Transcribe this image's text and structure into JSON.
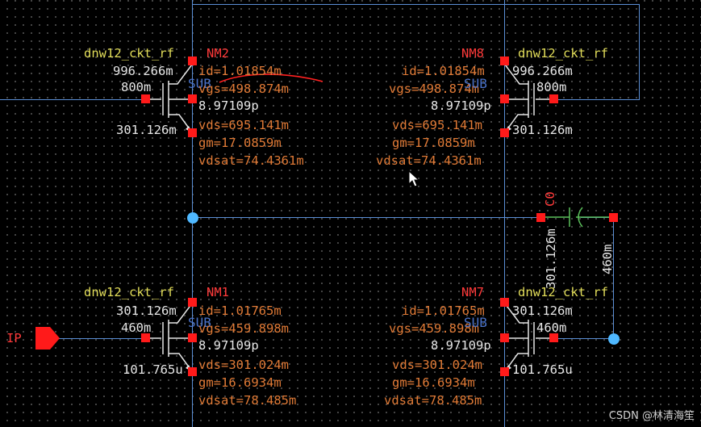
{
  "transistors": [
    {
      "name": "NM2",
      "model": "dnw12_ckt_rf",
      "w": "996.266m",
      "l": "800m",
      "bulk": "SUB",
      "cap": "8.97109p",
      "src": "301.126m",
      "id": "id=1.01854m",
      "vgs": "vgs=498.874m",
      "vds": "vds=695.141m",
      "gm": "gm=17.0859m",
      "vdsat": "vdsat=74.4361m"
    },
    {
      "name": "NM8",
      "model": "dnw12_ckt_rf",
      "w": "996.266m",
      "l": "800m",
      "bulk": "SUB",
      "cap": "8.97109p",
      "src": "301.126m",
      "id": "id=1.01854m",
      "vgs": "vgs=498.874m",
      "vds": "vds=695.141m",
      "gm": "gm=17.0859m",
      "vdsat": "vdsat=74.4361m"
    },
    {
      "name": "NM1",
      "model": "dnw12_ckt_rf",
      "w": "301.126m",
      "l": "460m",
      "bulk": "SUB",
      "cap": "8.97109p",
      "src": "101.765u",
      "id": "id=1.01765m",
      "vgs": "vgs=459.898m",
      "vds": "vds=301.024m",
      "gm": "gm=16.6934m",
      "vdsat": "vdsat=78.485m"
    },
    {
      "name": "NM7",
      "model": "dnw12_ckt_rf",
      "w": "301.126m",
      "l": "460m",
      "bulk": "SUB",
      "cap": "8.97109p",
      "src": "101.765u",
      "id": "id=1.01765m",
      "vgs": "vgs=459.898m",
      "vds": "vds=301.024m",
      "gm": "gm=16.6934m",
      "vdsat": "vdsat=78.485m"
    }
  ],
  "capacitor": {
    "name": "C0",
    "left_voltage": "301.126m",
    "right_voltage": "460m"
  },
  "input_pin": {
    "name": "IP"
  },
  "watermark": "CSDN @林清海笙",
  "colors": {
    "wire": "#5b8fd6",
    "pin": "#ff1a1a",
    "model": "#e2dd5a",
    "annotation": "#e07a36",
    "node_voltage": "#e6e6e6",
    "instance": "#ff3a3a"
  }
}
